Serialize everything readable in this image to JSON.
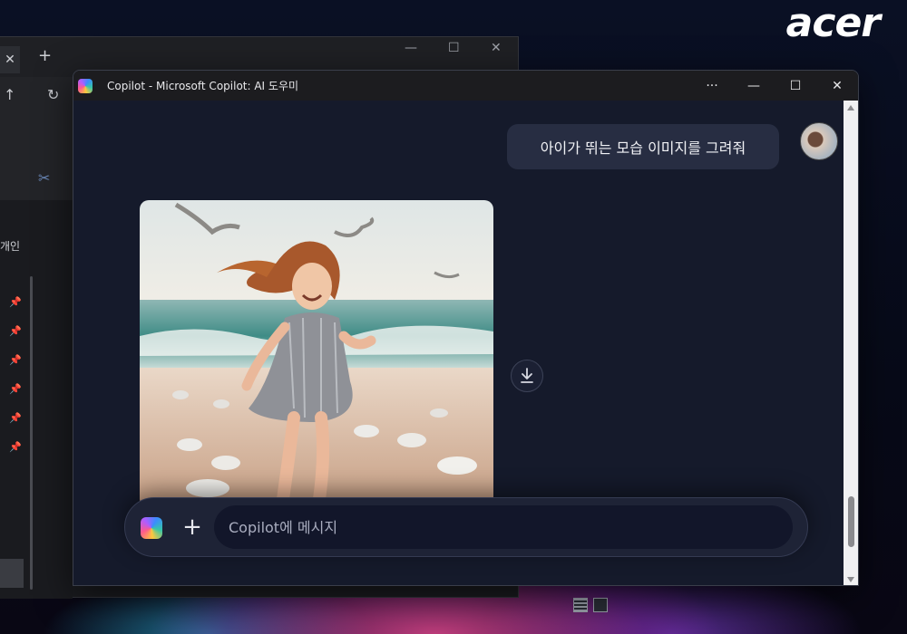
{
  "desktop": {
    "brand": "acer"
  },
  "explorer": {
    "tab_close": "✕",
    "new_tab": "+",
    "sidebar_label": "개인"
  },
  "copilot": {
    "window_title": "Copilot - Microsoft Copilot: AI 도우미",
    "controls": {
      "more": "···",
      "minimize": "—",
      "maximize": "☐",
      "close": "✕"
    },
    "user_message": "아이가 뛰는 모습 이미지를 그려줘",
    "composer": {
      "add_label": "+",
      "placeholder": "Copilot에 메시지"
    }
  },
  "colors": {
    "window_bg": "#151a2b",
    "bubble_bg": "#272d42",
    "composer_bg": "#1e2336"
  }
}
